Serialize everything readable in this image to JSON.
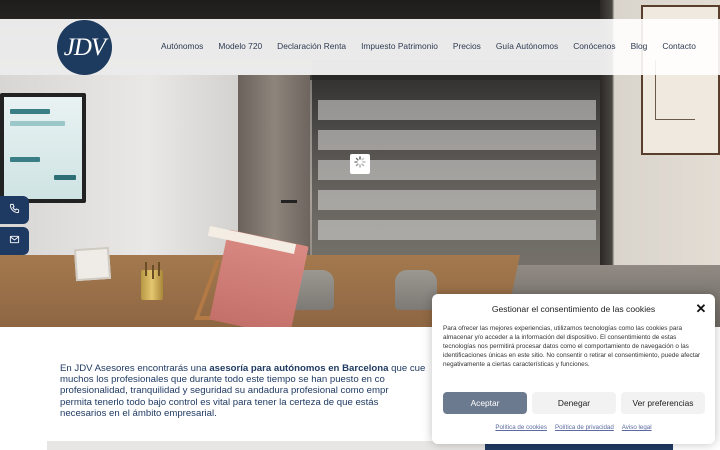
{
  "header": {
    "logo_text": "JDV",
    "nav": [
      {
        "label": "Autónomos"
      },
      {
        "label": "Modelo 720"
      },
      {
        "label": "Declaración Renta"
      },
      {
        "label": "Impuesto Patrimonio"
      },
      {
        "label": "Precios"
      },
      {
        "label": "Guía Autónomos"
      },
      {
        "label": "Conócenos"
      },
      {
        "label": "Blog"
      },
      {
        "label": "Contacto"
      }
    ]
  },
  "side_buttons": [
    {
      "icon": "phone-icon"
    },
    {
      "icon": "mail-icon"
    }
  ],
  "hero": {
    "loader_icon": "spinner-icon"
  },
  "intro": {
    "text_before": "En JDV Asesores encontrarás una ",
    "text_bold": "asesoría para autónomos en Barcelona",
    "text_after": " que cue",
    "line2": "muchos los profesionales que durante todo este tiempo se han puesto en co",
    "line3": "profesionalidad, tranquilidad y seguridad su andadura profesional como empr",
    "line4": "permita tenerlo todo bajo control es vital para tener la certeza de que estás",
    "line5": "necesarios en el ámbito empresarial."
  },
  "consent": {
    "title": "Gestionar el consentimiento de las cookies",
    "close_label": "✕",
    "body": "Para ofrecer las mejores experiencias, utilizamos tecnologías como las cookies para almacenar y/o acceder a la información del dispositivo. El consentimiento de estas tecnologías nos permitirá procesar datos como el comportamiento de navegación o las identificaciones únicas en este sitio. No consentir o retirar el consentimiento, puede afectar negativamente a ciertas características y funciones.",
    "accept_label": "Aceptar",
    "deny_label": "Denegar",
    "prefs_label": "Ver preferencias",
    "links": [
      {
        "label": "Política de cookies"
      },
      {
        "label": "Política de privacidad"
      },
      {
        "label": "Aviso legal"
      }
    ]
  },
  "colors": {
    "brand_navy": "#1f3a62",
    "accept_button": "#6c7a8f"
  }
}
